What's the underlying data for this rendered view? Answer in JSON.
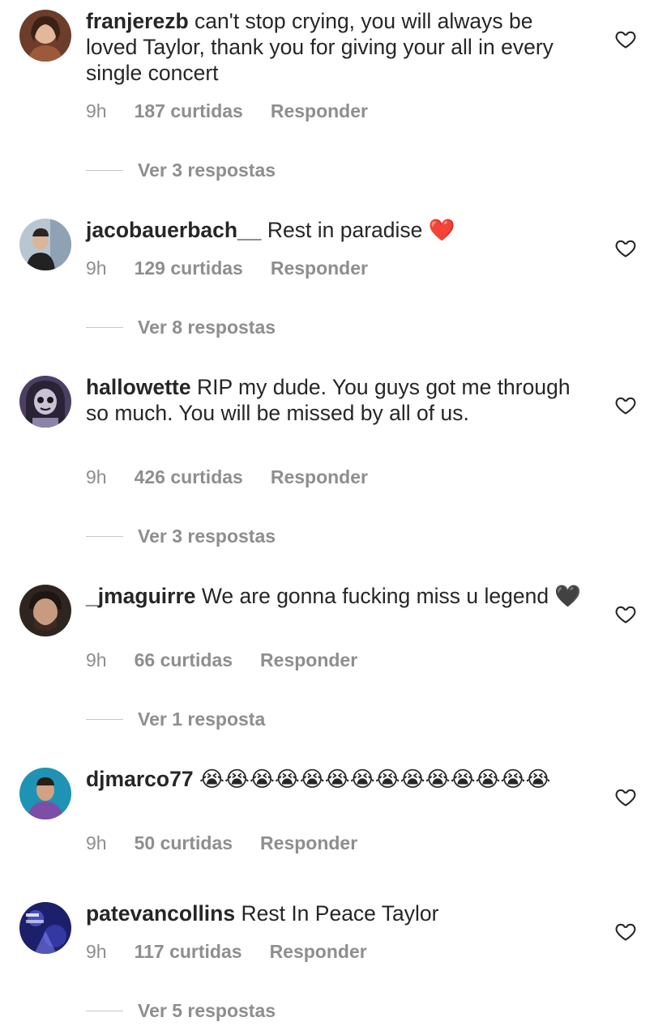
{
  "comments": [
    {
      "username": "franjerezb",
      "text": "can't stop crying, you will always be loved Taylor, thank you for giving your all in every single concert",
      "time": "9h",
      "likes": "187 curtidas",
      "reply": "Responder",
      "view_replies": "Ver 3 respostas",
      "avatar_color": "#8a5a3c"
    },
    {
      "username": "jacobauerbach__",
      "text": "Rest in paradise ❤️",
      "time": "9h",
      "likes": "129 curtidas",
      "reply": "Responder",
      "view_replies": "Ver 8 respostas",
      "avatar_color": "#7f95a8"
    },
    {
      "username": "hallowette",
      "text": "RIP my dude. You guys got me through so much. You will be missed by all of us.",
      "time": "9h",
      "likes": "426 curtidas",
      "reply": "Responder",
      "view_replies": "Ver 3 respostas",
      "avatar_color": "#5f4d78"
    },
    {
      "username": "_jmaguirre",
      "text": "We are gonna fucking miss u legend 🖤",
      "time": "9h",
      "likes": "66 curtidas",
      "reply": "Responder",
      "view_replies": "Ver 1 resposta",
      "avatar_color": "#3a2a22"
    },
    {
      "username": "djmarco77",
      "text": "😭😭😭😭😭😭😭😭😭😭😭😭😭😭",
      "time": "9h",
      "likes": "50 curtidas",
      "reply": "Responder",
      "view_replies": "",
      "avatar_color": "#2f8fb0"
    },
    {
      "username": "patevancollins",
      "text": "Rest In Peace Taylor",
      "time": "9h",
      "likes": "117 curtidas",
      "reply": "Responder",
      "view_replies": "Ver 5 respostas",
      "avatar_color": "#2b2f8a"
    }
  ],
  "colors": {
    "text": "#262626",
    "secondary": "#8e8e8e",
    "divider": "#c7c7c7"
  }
}
